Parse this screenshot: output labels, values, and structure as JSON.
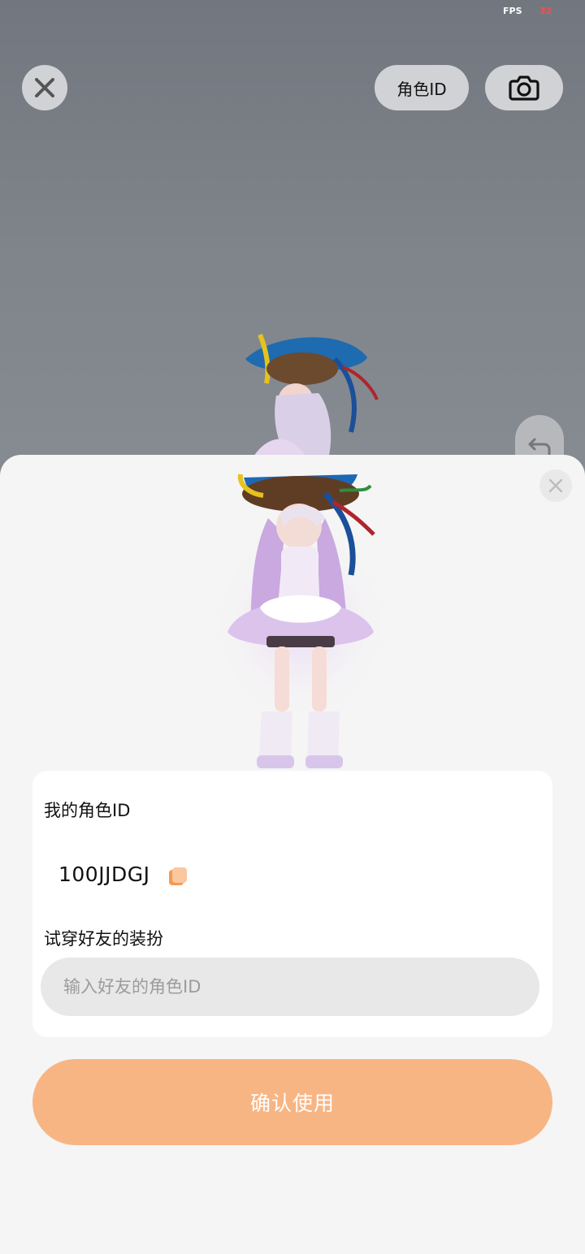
{
  "status": {
    "fps_label": "FPS",
    "fps_value": "32"
  },
  "toolbar": {
    "close_icon": "close-icon",
    "role_id_label": "角色ID",
    "camera_icon": "camera-icon",
    "undo_icon": "undo-arrow-icon"
  },
  "sheet": {
    "close_icon": "close-icon",
    "my_id_label": "我的角色ID",
    "my_id_value": "100JJDGJ",
    "copy_icon": "copy-icon",
    "try_on_label": "试穿好友的装扮",
    "friend_input_placeholder": "输入好友的角色ID",
    "friend_input_value": "",
    "confirm_label": "确认使用"
  },
  "colors": {
    "accent": "#f8b584",
    "copy_icon": "#f39a55",
    "input_bg": "#e8e8e8",
    "scene_bg": "#7d828a"
  }
}
